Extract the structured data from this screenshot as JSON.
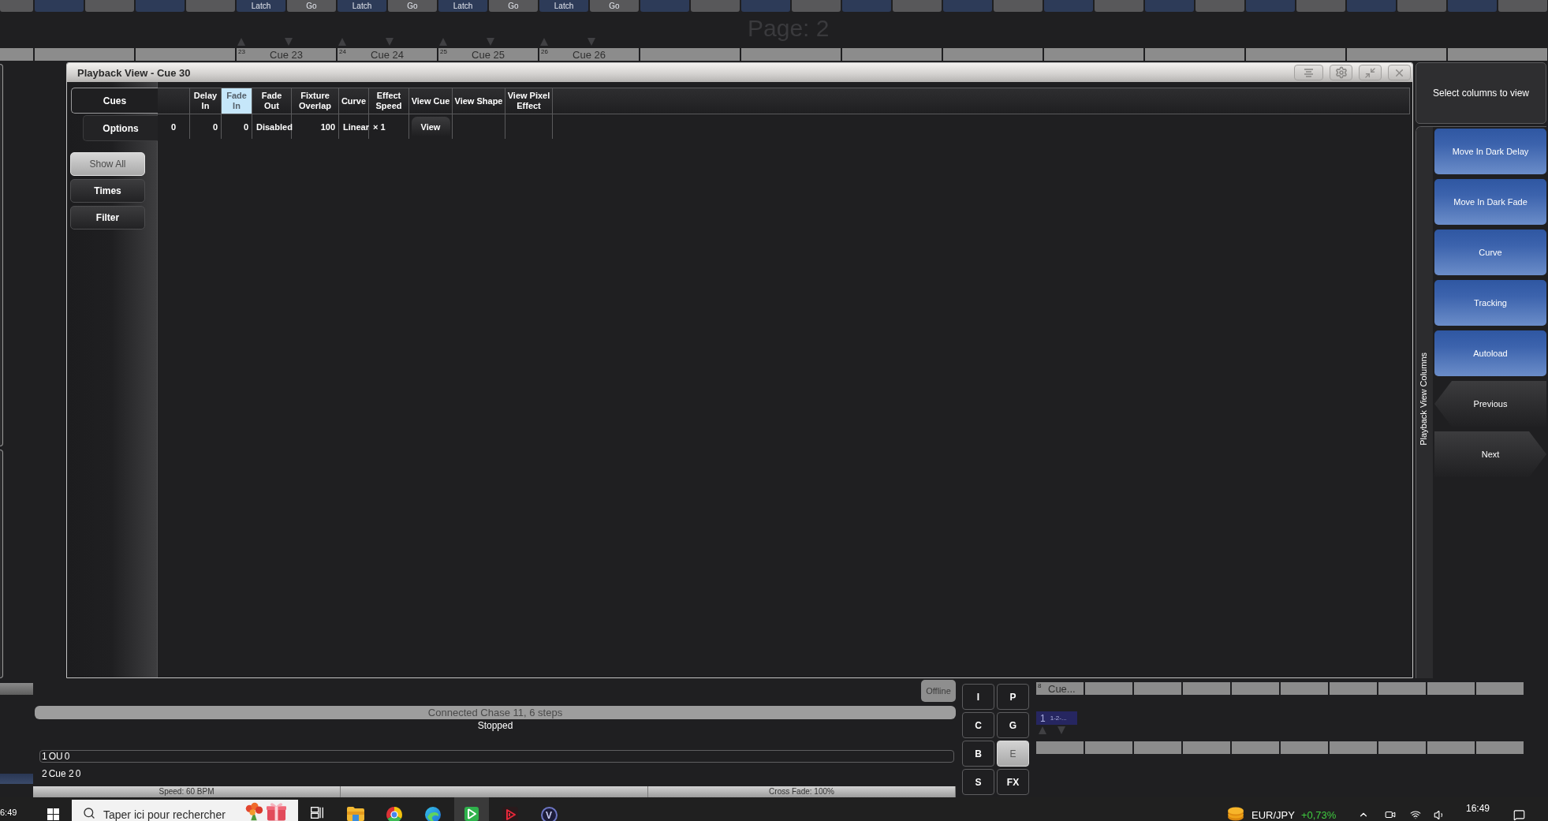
{
  "top_buttons": [
    {
      "color": "#58585a"
    },
    {
      "color": "#2d3b58"
    },
    {
      "color": "#58585a"
    },
    {
      "color": "#2d3b58"
    },
    {
      "color": "#58585a"
    },
    {
      "color": "#2d3b58",
      "label": "Latch"
    },
    {
      "color": "#58585a",
      "label": "Go"
    },
    {
      "color": "#2d3b58",
      "label": "Latch"
    },
    {
      "color": "#58585a",
      "label": "Go"
    },
    {
      "color": "#2d3b58",
      "label": "Latch"
    },
    {
      "color": "#58585a",
      "label": "Go"
    },
    {
      "color": "#2d3b58",
      "label": "Latch"
    },
    {
      "color": "#58585a",
      "label": "Go"
    },
    {
      "color": "#2d3b58"
    },
    {
      "color": "#58585a"
    },
    {
      "color": "#2d3b58"
    },
    {
      "color": "#58585a"
    },
    {
      "color": "#2d3b58"
    },
    {
      "color": "#58585a"
    },
    {
      "color": "#2d3b58"
    },
    {
      "color": "#58585a"
    },
    {
      "color": "#2d3b58"
    },
    {
      "color": "#58585a"
    },
    {
      "color": "#2d3b58"
    },
    {
      "color": "#58585a"
    },
    {
      "color": "#2d3b58"
    },
    {
      "color": "#58585a"
    },
    {
      "color": "#2d3b58"
    },
    {
      "color": "#58585a"
    },
    {
      "color": "#2d3b58"
    },
    {
      "color": "#58585a"
    }
  ],
  "page_label": "Page: 2",
  "cue_strip": [
    {
      "kind": "empty"
    },
    {
      "kind": "empty"
    },
    {
      "kind": "empty"
    },
    {
      "kind": "cue",
      "number": "23",
      "label": "Cue 23"
    },
    {
      "kind": "cue",
      "number": "24",
      "label": "Cue 24"
    },
    {
      "kind": "cue",
      "number": "25",
      "label": "Cue 25"
    },
    {
      "kind": "cue",
      "number": "26",
      "label": "Cue 26"
    },
    {
      "kind": "empty"
    },
    {
      "kind": "empty"
    },
    {
      "kind": "empty"
    },
    {
      "kind": "empty"
    },
    {
      "kind": "empty"
    },
    {
      "kind": "empty"
    },
    {
      "kind": "empty"
    },
    {
      "kind": "empty"
    },
    {
      "kind": "empty"
    }
  ],
  "window": {
    "title": "Playback View - Cue 30"
  },
  "tabs": [
    {
      "label": "Cues",
      "selected": true
    },
    {
      "label": "Options",
      "selected": false
    }
  ],
  "filter_buttons": [
    {
      "label": "Show All",
      "selected": true
    },
    {
      "label": "Times",
      "selected": false
    },
    {
      "label": "Filter",
      "selected": false
    }
  ],
  "table": {
    "columns": [
      {
        "selected": false
      },
      {
        "label": "Delay In",
        "selected": false
      },
      {
        "label": "Fade In",
        "selected": true
      },
      {
        "label": "Fade Out",
        "selected": false
      },
      {
        "label": "Fixture Overlap",
        "selected": false
      },
      {
        "label": "Curve",
        "selected": false
      },
      {
        "label": "Effect Speed",
        "selected": false
      },
      {
        "label": "View Cue",
        "selected": false
      },
      {
        "label": "View Shape",
        "selected": false
      },
      {
        "label": "View Pixel Effect",
        "selected": false
      }
    ],
    "rows": [
      {
        "cells": [
          {
            "kind": "index",
            "text": "0"
          },
          {
            "kind": "number",
            "text": "0"
          },
          {
            "kind": "number",
            "text": "0"
          },
          {
            "kind": "text",
            "text": "Disabled"
          },
          {
            "kind": "number",
            "text": "100"
          },
          {
            "kind": "text",
            "text": "Linear"
          },
          {
            "kind": "text",
            "text": "× 1"
          },
          {
            "kind": "button",
            "text": "View"
          }
        ]
      }
    ]
  },
  "column_picker": {
    "heading": "Select columns to view",
    "group_label": "Playback View Columns",
    "buttons": [
      {
        "kind": "column",
        "label": "Move In Dark Delay"
      },
      {
        "kind": "column",
        "label": "Move In Dark Fade"
      },
      {
        "kind": "column",
        "label": "Curve"
      },
      {
        "kind": "column",
        "label": "Tracking"
      },
      {
        "kind": "column",
        "label": "Autoload"
      },
      {
        "kind": "previous",
        "label": "Previous"
      },
      {
        "kind": "next",
        "label": "Next"
      }
    ]
  },
  "playback_status": {
    "connection": "Offline",
    "chase": "Connected Chase 11, 6 steps",
    "state": "Stopped",
    "steps": [
      {
        "number": "1",
        "name": "OU",
        "value": "0",
        "selected": true
      },
      {
        "number": "2",
        "name": "Cue 2",
        "value": "0",
        "selected": false
      }
    ],
    "speed": "Speed: 60 BPM",
    "cross_fade": "Cross Fade: 100%"
  },
  "keypad": [
    {
      "label": "I",
      "selected": false
    },
    {
      "label": "P",
      "selected": false
    },
    {
      "label": "C",
      "selected": false
    },
    {
      "label": "G",
      "selected": false
    },
    {
      "label": "B",
      "selected": false
    },
    {
      "label": "E",
      "selected": true
    },
    {
      "label": "S",
      "selected": false
    },
    {
      "label": "FX",
      "selected": false
    }
  ],
  "mini_playback": {
    "upper_cells": [
      {
        "kind": "cue",
        "number": "8",
        "label": "Cue..."
      },
      {
        "kind": "empty"
      },
      {
        "kind": "empty"
      },
      {
        "kind": "empty"
      },
      {
        "kind": "empty"
      },
      {
        "kind": "empty"
      },
      {
        "kind": "empty"
      },
      {
        "kind": "empty"
      },
      {
        "kind": "empty"
      },
      {
        "kind": "empty"
      }
    ],
    "current": {
      "index": "1",
      "range": "1-2-..."
    },
    "lower_cells": [
      {
        "kind": "empty"
      },
      {
        "kind": "empty"
      },
      {
        "kind": "empty"
      },
      {
        "kind": "empty"
      },
      {
        "kind": "empty"
      },
      {
        "kind": "empty"
      },
      {
        "kind": "empty"
      },
      {
        "kind": "empty"
      },
      {
        "kind": "empty"
      },
      {
        "kind": "empty"
      }
    ]
  },
  "taskbar": {
    "partial_clock": "6:49",
    "search": {
      "placeholder": "Taper ici pour rechercher"
    },
    "apps": [
      {
        "kind": "task-view",
        "selected": false
      },
      {
        "kind": "folder",
        "selected": false
      },
      {
        "kind": "ring",
        "selected": false
      },
      {
        "kind": "swirl",
        "selected": false
      },
      {
        "kind": "play-tile",
        "selected": true
      },
      {
        "kind": "play-outline",
        "selected": false
      },
      {
        "kind": "letter",
        "glyph": "V",
        "selected": false
      }
    ],
    "ticker": {
      "symbol": "EUR/JPY",
      "change": "+0,73%"
    },
    "clock": "16:49"
  }
}
